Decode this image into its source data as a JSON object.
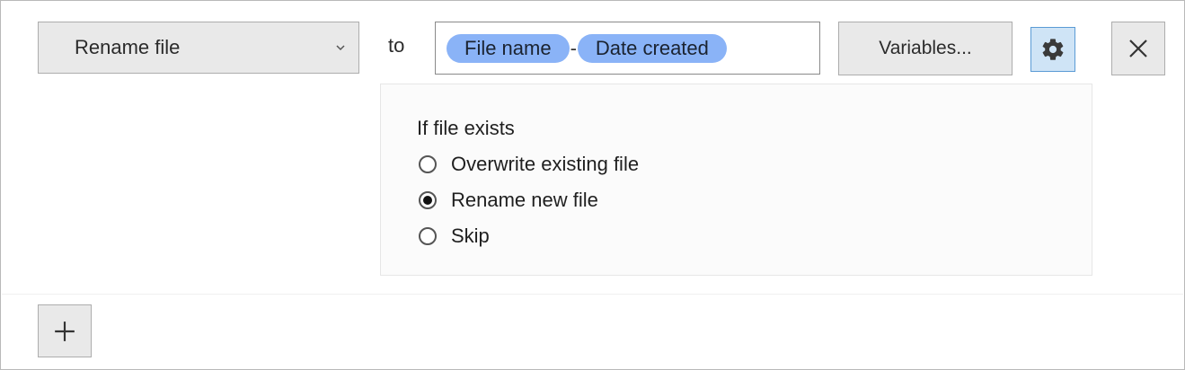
{
  "action": {
    "selected": "Rename file",
    "to_label": "to"
  },
  "pattern": {
    "tokens": [
      "File name",
      "Date created"
    ],
    "separator": "-"
  },
  "buttons": {
    "variables_label": "Variables...",
    "settings_icon": "gear-icon",
    "close_icon": "close-icon",
    "add_icon": "plus-icon"
  },
  "options": {
    "title": "If file exists",
    "choices": [
      {
        "label": "Overwrite existing file",
        "checked": false
      },
      {
        "label": "Rename new file",
        "checked": true
      },
      {
        "label": "Skip",
        "checked": false
      }
    ]
  },
  "colors": {
    "token_bg": "#8ab3f7",
    "gear_button_bg": "#cfe4f6",
    "gear_button_border": "#5b9bd5",
    "button_bg": "#e9e9e9"
  }
}
